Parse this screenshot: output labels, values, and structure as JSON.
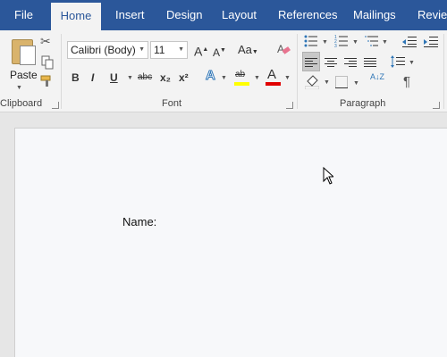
{
  "tabs": {
    "file": "File",
    "home": "Home",
    "insert": "Insert",
    "design": "Design",
    "layout": "Layout",
    "references": "References",
    "mailings": "Mailings",
    "review": "Revie"
  },
  "clipboard": {
    "paste_label": "Paste",
    "group_label": "Clipboard"
  },
  "font": {
    "font_name": "Calibri (Body)",
    "font_size": "11",
    "bold": "B",
    "italic": "I",
    "underline": "U",
    "strike": "abc",
    "subscript": "x₂",
    "superscript": "x²",
    "change_case": "Aa",
    "grow": "A",
    "shrink": "A",
    "text_effects": "A",
    "highlight": "ab",
    "font_color": "A",
    "group_label": "Font",
    "highlight_color": "#ffff00",
    "font_color_value": "#e00000"
  },
  "paragraph": {
    "group_label": "Paragraph",
    "sort": "A↓Z",
    "show_marks": "¶"
  },
  "document": {
    "text": "Name:"
  },
  "colors": {
    "tabbar": "#2b579a",
    "ribbon": "#f3f3f3"
  }
}
